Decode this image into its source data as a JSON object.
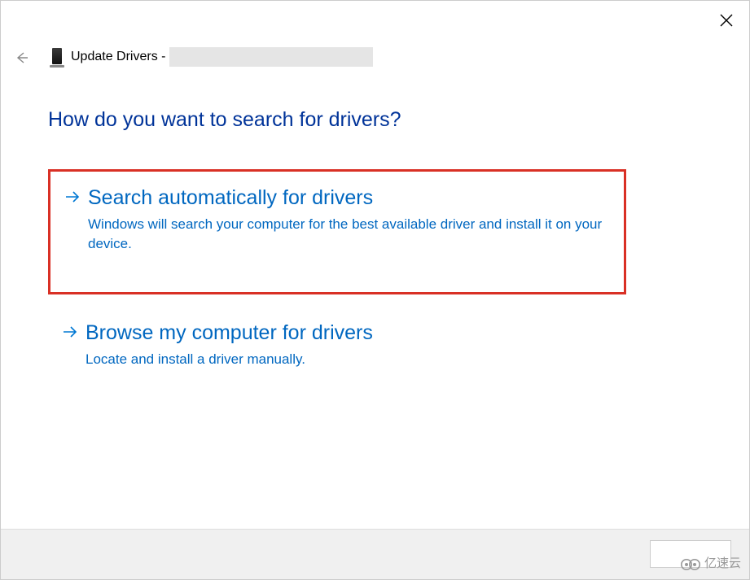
{
  "header": {
    "title_prefix": "Update Drivers -"
  },
  "heading": "How do you want to search for drivers?",
  "options": [
    {
      "title": "Search automatically for drivers",
      "description": "Windows will search your computer for the best available driver and install it on your device."
    },
    {
      "title": "Browse my computer for drivers",
      "description": "Locate and install a driver manually."
    }
  ],
  "watermark": "亿速云"
}
